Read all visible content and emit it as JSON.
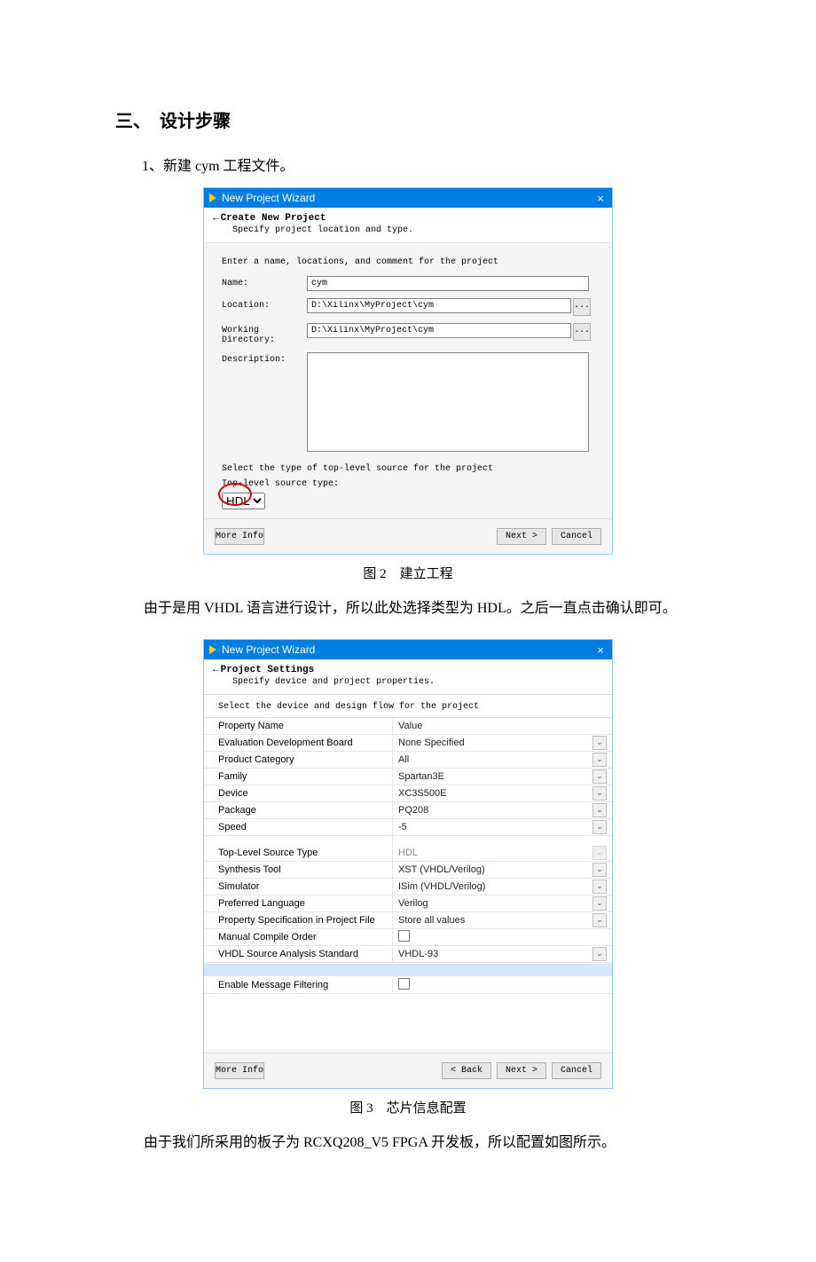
{
  "heading": "三、　设计步骤",
  "step1": "1、新建 cym 工程文件。",
  "caption1": "图 2　建立工程",
  "paragraph1": "由于是用 VHDL 语言进行设计，所以此处选择类型为 HDL。之后一直点击确认即可。",
  "caption2": "图 3　芯片信息配置",
  "paragraph2": "由于我们所采用的板子为 RCXQ208_V5 FPGA 开发板，所以配置如图所示。",
  "win1": {
    "title": "New Project Wizard",
    "close": "×",
    "header_title": "Create New Project",
    "header_sub": "Specify project location and type.",
    "intro": "Enter a name, locations, and comment for the project",
    "lbl_name": "Name:",
    "val_name": "cym",
    "lbl_loc": "Location:",
    "val_loc": "D:\\Xilinx\\MyProject\\cym",
    "lbl_wd": "Working Directory:",
    "val_wd": "D:\\Xilinx\\MyProject\\cym",
    "lbl_desc": "Description:",
    "browse": "...",
    "intro2": "Select the type of top-level source for the project",
    "intro3": "Top-level source type:",
    "val_type": "HDL",
    "btn_more": "More Info",
    "btn_next": "Next >",
    "btn_cancel": "Cancel"
  },
  "win2": {
    "title": "New Project Wizard",
    "close": "×",
    "header_title": "Project Settings",
    "header_sub": "Specify device and project properties.",
    "intro": "Select the device and design flow for the project",
    "col1": "Property Name",
    "col2": "Value",
    "rows1": [
      {
        "name": "Evaluation Development Board",
        "value": "None Specified",
        "combo": true
      },
      {
        "name": "Product Category",
        "value": "All",
        "combo": true
      },
      {
        "name": "Family",
        "value": "Spartan3E",
        "combo": true
      },
      {
        "name": "Device",
        "value": "XC3S500E",
        "combo": true
      },
      {
        "name": "Package",
        "value": "PQ208",
        "combo": true
      },
      {
        "name": "Speed",
        "value": "-5",
        "combo": true
      }
    ],
    "rows2": [
      {
        "name": "Top-Level Source Type",
        "value": "HDL",
        "combo": true,
        "disabled": true
      },
      {
        "name": "Synthesis Tool",
        "value": "XST (VHDL/Verilog)",
        "combo": true
      },
      {
        "name": "Simulator",
        "value": "ISim (VHDL/Verilog)",
        "combo": true
      },
      {
        "name": "Preferred Language",
        "value": "Verilog",
        "combo": true
      },
      {
        "name": "Property Specification in Project File",
        "value": "Store all values",
        "combo": true
      },
      {
        "name": "Manual Compile Order",
        "value": "",
        "checkbox": true
      },
      {
        "name": "VHDL Source Analysis Standard",
        "value": "VHDL-93",
        "combo": true
      }
    ],
    "rows3": [
      {
        "name": "Enable Message Filtering",
        "value": "",
        "checkbox": true
      }
    ],
    "btn_more": "More Info",
    "btn_back": "< Back",
    "btn_next": "Next >",
    "btn_cancel": "Cancel"
  }
}
